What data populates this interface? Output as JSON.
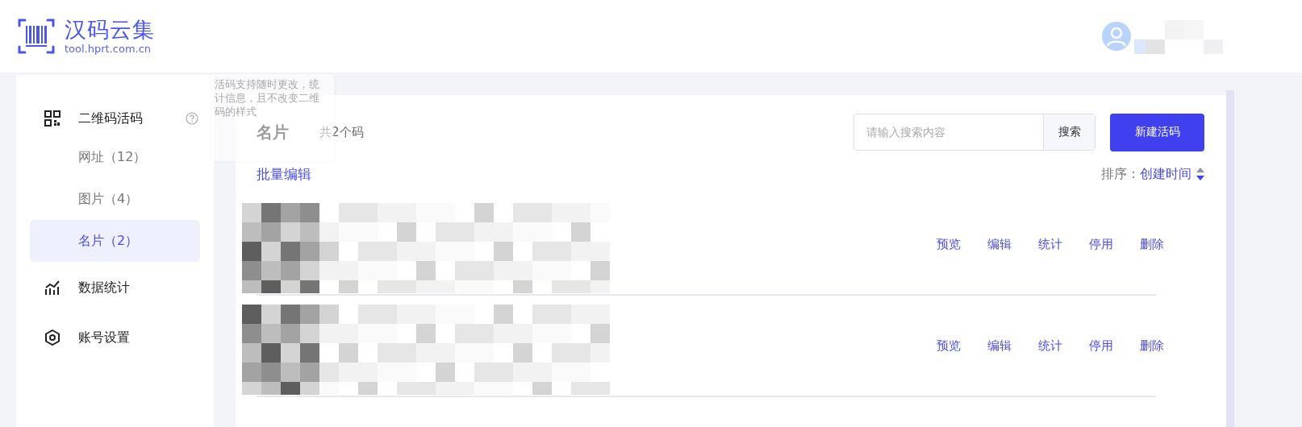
{
  "header": {
    "logo_title": "汉码云集",
    "logo_url": "tool.hprt.com.cn"
  },
  "sidebar": {
    "items": [
      {
        "kind": "qr",
        "label": "二维码活码",
        "help": true,
        "children": [
          {
            "label": "网址（12）",
            "selected": false
          },
          {
            "label": "图片（4）",
            "selected": false
          },
          {
            "label": "名片（2）",
            "selected": true
          }
        ]
      },
      {
        "kind": "stats",
        "label": "数据统计"
      },
      {
        "kind": "settings",
        "label": "账号设置"
      }
    ]
  },
  "tooltip": {
    "text": "活码支持随时更改，统计信息，且不改变二维码的样式"
  },
  "main": {
    "title": "名片",
    "count": "共2个码",
    "search": {
      "placeholder": "请输入搜索内容",
      "button": "搜索"
    },
    "new_button": "新建活码",
    "batch_edit": "批量编辑",
    "sort": {
      "label": "排序：",
      "value": "创建时间",
      "descending": true
    },
    "rows": [
      {
        "kind": "picture",
        "actions": [
          "预览",
          "编辑",
          "统计",
          "停用",
          "删除"
        ]
      },
      {
        "kind": "picture",
        "actions": [
          "预览",
          "编辑",
          "统计",
          "停用",
          "删除"
        ]
      }
    ]
  }
}
